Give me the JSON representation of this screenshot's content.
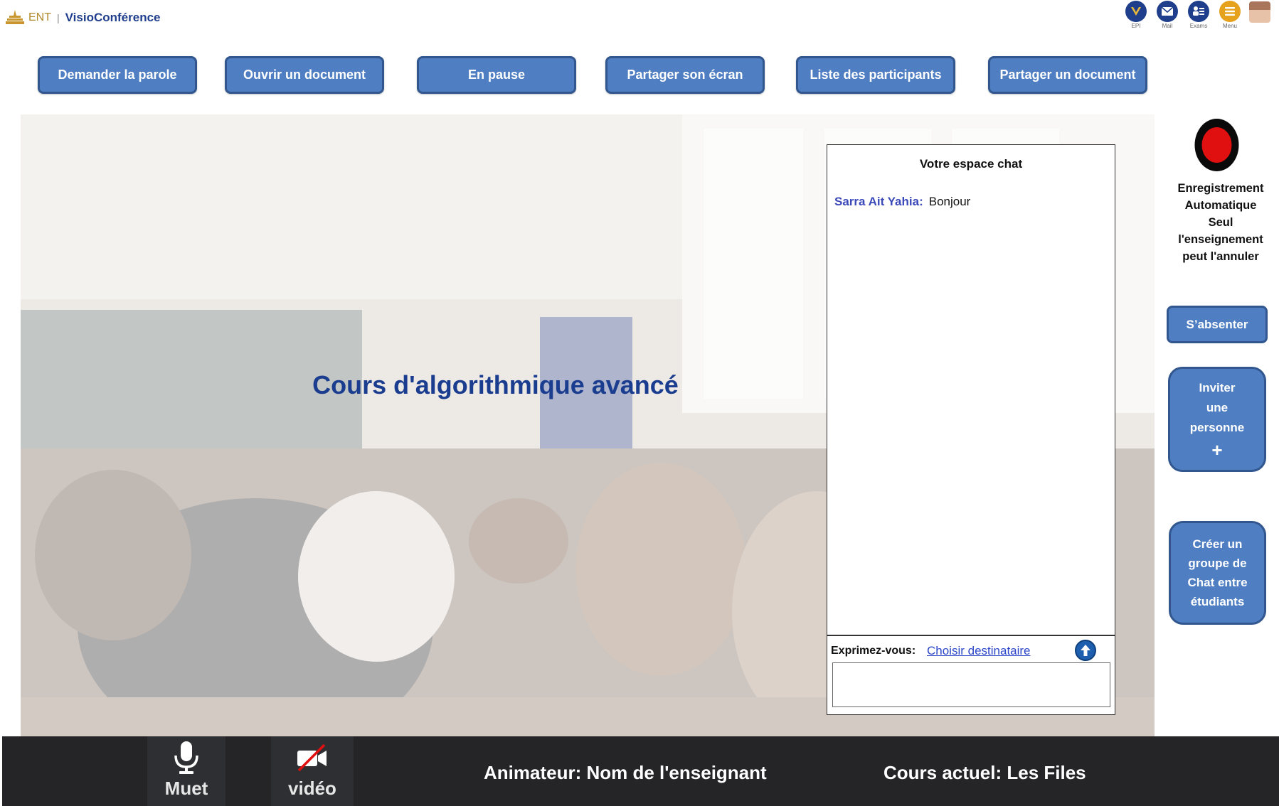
{
  "header": {
    "logo_ent": "ENT",
    "logo_separator": "|",
    "app_title": "VisioConférence",
    "top_icons": [
      {
        "icon": "epi-icon",
        "label": "EPI",
        "color": "#1f3f8c"
      },
      {
        "icon": "mail-icon",
        "label": "Mail",
        "color": "#1f3f8c"
      },
      {
        "icon": "exams-icon",
        "label": "Exams",
        "color": "#1f3f8c"
      },
      {
        "icon": "menu-icon",
        "label": "Menu",
        "color": "#e6a21c"
      }
    ],
    "avatar": "user-avatar"
  },
  "toolbar": {
    "buttons": [
      {
        "label": "Demander la parole"
      },
      {
        "label": "Ouvrir un document"
      },
      {
        "label": "En pause"
      },
      {
        "label": "Partager son écran"
      },
      {
        "label": "Liste des participants"
      },
      {
        "label": "Partager un document"
      }
    ]
  },
  "stage": {
    "title": "Cours d'algorithmique avancé"
  },
  "chat": {
    "title": "Votre espace chat",
    "messages": [
      {
        "author": "Sarra Ait Yahia:",
        "text": "Bonjour"
      }
    ],
    "compose_label": "Exprimez-vous:",
    "recipient_link": "Choisir destinataire",
    "input_value": ""
  },
  "side": {
    "recording_lines": [
      "Enregistrement",
      "Automatique",
      "Seul",
      "l'enseignement",
      "peut l'annuler"
    ],
    "absent_label": "S’absenter",
    "invite_lines": [
      "Inviter",
      "une",
      "personne"
    ],
    "invite_plus": "+",
    "group_lines": [
      "Créer un",
      "groupe de",
      "Chat entre",
      "étudiants"
    ]
  },
  "footer": {
    "mute_label": "Muet",
    "video_label": "vidéo",
    "animator_text": "Animateur: Nom de l'enseignant",
    "course_text": "Cours actuel: Les Files"
  },
  "colors": {
    "button_fill": "#4f7fc2",
    "button_border": "#32578f",
    "title_blue": "#1b3d8f",
    "footer_bg": "#252528",
    "record_red": "#e01010"
  }
}
